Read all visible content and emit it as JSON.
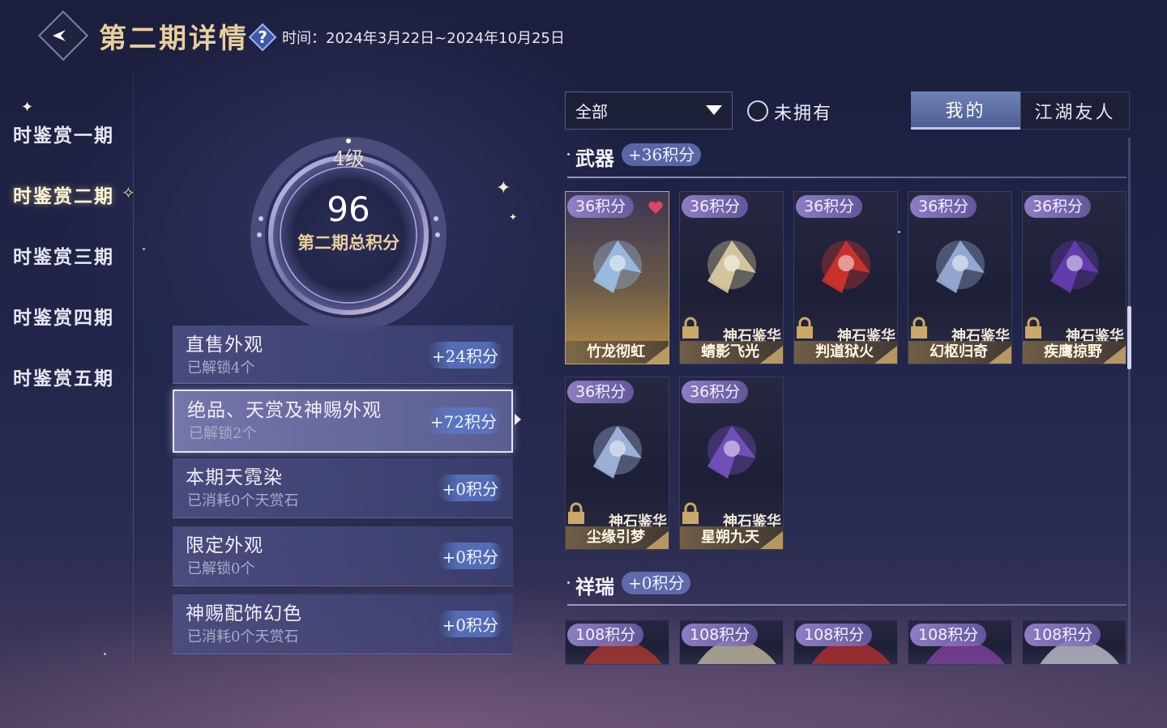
{
  "header": {
    "title": "第二期详情",
    "time_label": "时间：",
    "time_value": "2024年3月22日~2024年10月25日"
  },
  "sidebar": {
    "items": [
      {
        "label": "时鉴赏一期"
      },
      {
        "label": "时鉴赏二期"
      },
      {
        "label": "时鉴赏三期"
      },
      {
        "label": "时鉴赏四期"
      },
      {
        "label": "时鉴赏五期"
      }
    ],
    "active_index": 1
  },
  "summary": {
    "level": "4级",
    "score": "96",
    "caption": "第二期总积分"
  },
  "categories": [
    {
      "name": "直售外观",
      "sub": "已解锁4个",
      "points": "+24积分"
    },
    {
      "name": "绝品、天赏及神赐外观",
      "sub": "已解锁2个",
      "points": "+72积分"
    },
    {
      "name": "本期天霓染",
      "sub": "已消耗0个天赏石",
      "points": "+0积分"
    },
    {
      "name": "限定外观",
      "sub": "已解锁0个",
      "points": "+0积分"
    },
    {
      "name": "神赐配饰幻色",
      "sub": "已消耗0个天赏石",
      "points": "+0积分"
    }
  ],
  "filters": {
    "select_value": "全部",
    "unowned_label": "未拥有",
    "tabs": [
      {
        "label": "我的"
      },
      {
        "label": "江湖友人"
      }
    ]
  },
  "sections": [
    {
      "title": "武器",
      "points": "+36积分",
      "items": [
        {
          "points": "36积分",
          "type": "",
          "name": "竹龙彻虹",
          "owned": true,
          "art_color": "#9fc4ee"
        },
        {
          "points": "36积分",
          "type": "神石鉴华",
          "name": "蜻影飞光",
          "owned": false,
          "art_color": "#e6d6a6"
        },
        {
          "points": "36积分",
          "type": "神石鉴华",
          "name": "判道狱火",
          "owned": false,
          "art_color": "#d9352a"
        },
        {
          "points": "36积分",
          "type": "神石鉴华",
          "name": "幻枢归奇",
          "owned": false,
          "art_color": "#9fb6df"
        },
        {
          "points": "36积分",
          "type": "神石鉴华",
          "name": "疾鹰掠野",
          "owned": false,
          "art_color": "#6a3fb8"
        },
        {
          "points": "36积分",
          "type": "神石鉴华",
          "name": "尘缘引梦",
          "owned": false,
          "art_color": "#a9bee6"
        },
        {
          "points": "36积分",
          "type": "神石鉴华",
          "name": "星朔九天",
          "owned": false,
          "art_color": "#7a55c8"
        }
      ]
    },
    {
      "title": "祥瑞",
      "points": "+0积分",
      "items": [
        {
          "points": "108积分",
          "art_color": "#c0392b"
        },
        {
          "points": "108积分",
          "art_color": "#d8cfae"
        },
        {
          "points": "108积分",
          "art_color": "#c6302c"
        },
        {
          "points": "108积分",
          "art_color": "#8e44ad"
        },
        {
          "points": "108积分",
          "art_color": "#d6d6de"
        }
      ]
    }
  ],
  "colors": {
    "accent_gold": "#e8cf9c",
    "points_badge": "#6e7dc8",
    "background": "#202549"
  }
}
